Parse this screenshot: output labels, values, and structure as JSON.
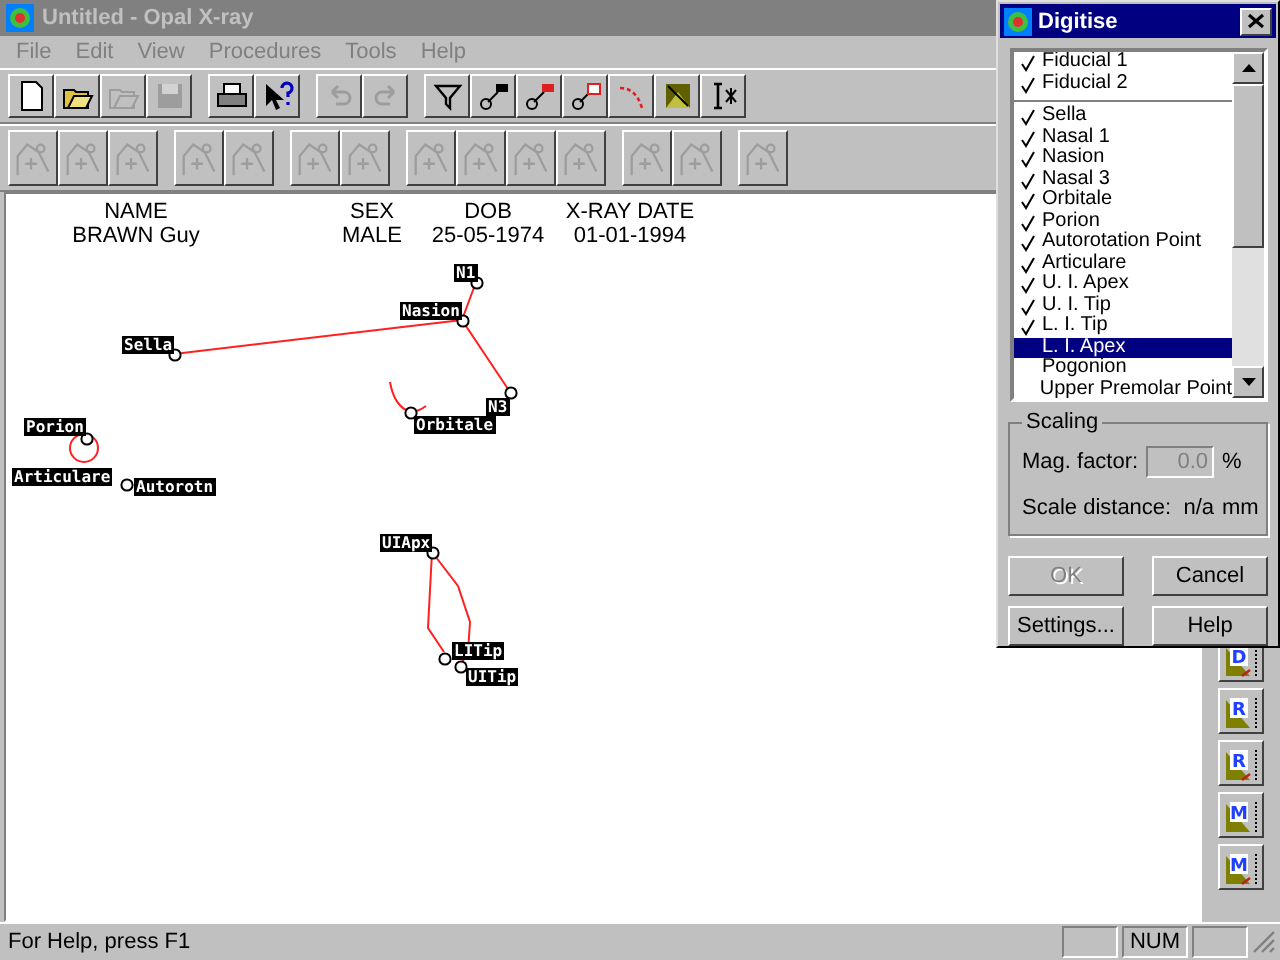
{
  "window": {
    "title": "Untitled - Opal X-ray"
  },
  "menu": [
    "File",
    "Edit",
    "View",
    "Procedures",
    "Tools",
    "Help"
  ],
  "toolbar_1": [
    [
      {
        "kind": "new",
        "disabled": false
      },
      {
        "kind": "open",
        "disabled": false
      },
      {
        "kind": "open",
        "disabled": true
      },
      {
        "kind": "save",
        "disabled": true
      }
    ],
    [
      {
        "kind": "print",
        "disabled": false
      },
      {
        "kind": "context-help",
        "disabled": false
      }
    ],
    [
      {
        "kind": "undo",
        "disabled": true
      },
      {
        "kind": "redo",
        "disabled": true
      }
    ],
    [
      {
        "kind": "funnel",
        "disabled": false
      },
      {
        "kind": "point",
        "disabled": false
      },
      {
        "kind": "point-red",
        "disabled": false
      },
      {
        "kind": "point-flag",
        "disabled": false
      },
      {
        "kind": "curve",
        "disabled": false
      },
      {
        "kind": "image",
        "disabled": false
      },
      {
        "kind": "cursor",
        "disabled": false
      }
    ]
  ],
  "toolbar_2": [
    [
      {
        "kind": "trace",
        "disabled": true
      },
      {
        "kind": "trace",
        "disabled": true
      },
      {
        "kind": "trace",
        "disabled": true
      }
    ],
    [
      {
        "kind": "trace",
        "disabled": true
      },
      {
        "kind": "trace",
        "disabled": true
      }
    ],
    [
      {
        "kind": "trace",
        "disabled": true
      },
      {
        "kind": "trace",
        "disabled": true
      }
    ],
    [
      {
        "kind": "trace",
        "disabled": true
      },
      {
        "kind": "trace",
        "disabled": true
      },
      {
        "kind": "trace",
        "disabled": true
      },
      {
        "kind": "trace",
        "disabled": true
      }
    ],
    [
      {
        "kind": "trace",
        "disabled": true
      },
      {
        "kind": "trace",
        "disabled": true
      }
    ],
    [
      {
        "kind": "trace",
        "disabled": true
      }
    ]
  ],
  "patient": [
    {
      "heading": "NAME",
      "value": "BRAWN Guy"
    },
    {
      "heading": "SEX",
      "value": "MALE"
    },
    {
      "heading": "DOB",
      "value": "25-05-1974"
    },
    {
      "heading": "X-RAY DATE",
      "value": "01-01-1994"
    }
  ],
  "landmarks": [
    {
      "label": "N1"
    },
    {
      "label": "Nasion"
    },
    {
      "label": "Sella"
    },
    {
      "label": "N3"
    },
    {
      "label": "Orbitale"
    },
    {
      "label": "Porion"
    },
    {
      "label": "Articulare"
    },
    {
      "label": "Autorotn"
    },
    {
      "label": "UIApx"
    },
    {
      "label": "LITip"
    },
    {
      "label": "UITip"
    }
  ],
  "right_toolbar": [
    {
      "letter": "D"
    },
    {
      "letter": "R"
    },
    {
      "letter": "R"
    },
    {
      "letter": "M"
    },
    {
      "letter": "M"
    }
  ],
  "digitise": {
    "title": "Digitise",
    "fiducials": [
      {
        "label": "Fiducial 1",
        "checked": true,
        "selected": false
      },
      {
        "label": "Fiducial 2",
        "checked": true,
        "selected": false
      }
    ],
    "points": [
      {
        "label": "Sella",
        "checked": true,
        "selected": false
      },
      {
        "label": "Nasal 1",
        "checked": true,
        "selected": false
      },
      {
        "label": "Nasion",
        "checked": true,
        "selected": false
      },
      {
        "label": "Nasal 3",
        "checked": true,
        "selected": false
      },
      {
        "label": "Orbitale",
        "checked": true,
        "selected": false
      },
      {
        "label": "Porion",
        "checked": true,
        "selected": false
      },
      {
        "label": "Autorotation Point",
        "checked": true,
        "selected": false
      },
      {
        "label": "Articulare",
        "checked": true,
        "selected": false
      },
      {
        "label": "U. I. Apex",
        "checked": true,
        "selected": false
      },
      {
        "label": "U. I. Tip",
        "checked": true,
        "selected": false
      },
      {
        "label": "L. I. Tip",
        "checked": true,
        "selected": false
      },
      {
        "label": "L. I. Apex",
        "checked": false,
        "selected": true
      },
      {
        "label": "Pogonion",
        "checked": false,
        "selected": false
      },
      {
        "label": "Upper Premolar Point",
        "checked": false,
        "selected": false
      }
    ],
    "scaling": {
      "title": "Scaling",
      "mag_label": "Mag. factor:",
      "mag_value": "0.0",
      "mag_unit": "%",
      "dist_label": "Scale distance:",
      "dist_value": "n/a",
      "dist_unit": "mm"
    },
    "buttons": [
      {
        "label": "OK",
        "disabled": true
      },
      {
        "label": "Cancel",
        "disabled": false
      },
      {
        "label": "Settings...",
        "disabled": false
      },
      {
        "label": "Help",
        "disabled": false
      }
    ]
  },
  "status_bar": {
    "text": "For Help, press F1",
    "num_indicator": "NUM"
  }
}
